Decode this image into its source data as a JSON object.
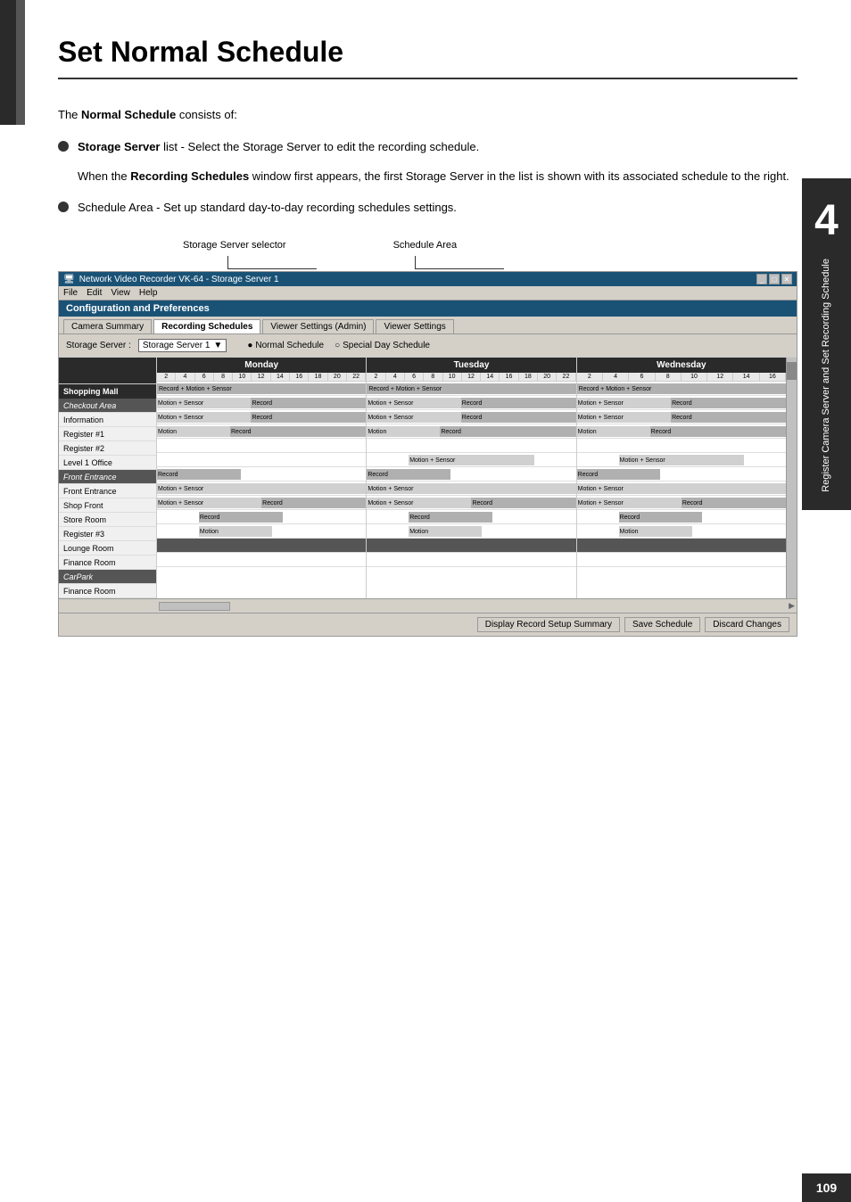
{
  "page": {
    "title": "Set Normal Schedule",
    "chapter_number": "4",
    "chapter_text": "Register Camera Server and Set Recording Schedule",
    "page_number": "109"
  },
  "content": {
    "intro": "The Normal Schedule consists of:",
    "bullets": [
      {
        "label": "Storage Server",
        "text": " list - Select the Storage Server to edit the recording schedule."
      },
      {
        "text": "Schedule Area - Set up standard day-to-day recording schedules settings."
      }
    ],
    "indented": "When the Recording Schedules window first appears, the first Storage Server in the list is shown with its associated schedule to the right."
  },
  "diagram": {
    "label1": "Storage Server selector",
    "label2": "Schedule Area"
  },
  "app": {
    "title_bar": "Network Video Recorder VK-64 - Storage Server 1",
    "menu_items": [
      "File",
      "Edit",
      "View",
      "Help"
    ],
    "config_panel_title": "Configuration and Preferences",
    "tabs": [
      "Camera Summary",
      "Recording Schedules",
      "Viewer Settings (Admin)",
      "Viewer Settings"
    ],
    "active_tab": "Recording Schedules",
    "storage_label": "Storage Server :",
    "storage_server": "Storage Server 1",
    "radio_options": [
      "Normal Schedule",
      "Special Day Schedule"
    ],
    "active_radio": "Normal Schedule",
    "days": [
      "Monday",
      "Tuesday",
      "Wednesday"
    ],
    "time_ticks": [
      "2",
      "4",
      "6",
      "8",
      "10",
      "12",
      "14",
      "16",
      "18",
      "20",
      "22",
      "2",
      "4",
      "6",
      "8",
      "10",
      "12",
      "14",
      "16",
      "18",
      "20",
      "22",
      "2",
      "4",
      "6",
      "8",
      "10",
      "12",
      "14",
      "16"
    ],
    "camera_groups": [
      {
        "name": "Shopping Mall",
        "cameras": [
          {
            "name": "Checkout Area",
            "type": "subheader"
          },
          {
            "name": "Information",
            "schedules": [
              "Record + Motion + Sensor",
              "Record + Motion + Sensor",
              "Record + Motion + Sensor"
            ]
          },
          {
            "name": "Register #1",
            "schedules": [
              "Motion + Sensor Record",
              "Motion + Sensor Record",
              "Motion + Sensor Record"
            ]
          },
          {
            "name": "Register #2",
            "schedules": [
              "Motion + Sensor Record",
              "Motion + Sensor Record",
              "Motion + Sensor Record"
            ]
          },
          {
            "name": "Level 1 Office",
            "schedules": [
              "Motion Record",
              "Motion Record",
              "Motion Record"
            ]
          },
          {
            "name": "Front Entrance",
            "type": "subheader"
          },
          {
            "name": "Front Entrance",
            "schedules": [
              "",
              "Motion + Sensor",
              "Motion + Sensor"
            ]
          },
          {
            "name": "Shop Front",
            "schedules": [
              "Record",
              "Record",
              "Record"
            ]
          },
          {
            "name": "Store Room",
            "schedules": [
              "Motion + Sensor",
              "Motion + Sensor",
              "Motion + Sensor"
            ]
          },
          {
            "name": "Register #3",
            "schedules": [
              "Motion + Sensor Record",
              "Motion + Sensor Record",
              "Motion + Sensor Record"
            ]
          },
          {
            "name": "Lounge Room",
            "schedules": [
              "Record",
              "Record",
              "Record"
            ]
          },
          {
            "name": "Finance Room",
            "schedules": [
              "Motion",
              "Motion",
              "Motion"
            ]
          },
          {
            "name": "CarPark",
            "type": "subheader"
          },
          {
            "name": "Finance Room",
            "schedules": [
              "",
              "",
              ""
            ]
          }
        ]
      }
    ],
    "buttons": [
      "Display Record Setup Summary",
      "Save Schedule",
      "Discard Changes"
    ]
  }
}
